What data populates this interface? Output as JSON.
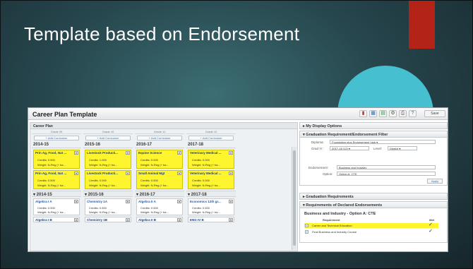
{
  "slide": {
    "title": "Template based on Endorsement",
    "colors": {
      "background": "#27474e",
      "accent_red": "#b32317",
      "accent_teal": "#46bfd0",
      "highlight": "#fff52e"
    }
  },
  "app": {
    "title": "Career Plan Template",
    "toolbar": {
      "icons": [
        "chart-icon",
        "grid-icon",
        "report-icon",
        "settings-icon",
        "print-icon",
        "help-icon"
      ],
      "save_label": "Save"
    }
  },
  "career_plan": {
    "header": "Career Plan",
    "columns": [
      {
        "grade": "Grade 09",
        "add": "+ Add Curriculum",
        "year": "2014-15",
        "courses": [
          {
            "name": "Prin Ag, Food, Nat ...",
            "credits": "Credits: 0.500",
            "weight": "Weight: N-Reg (+ ba..."
          },
          {
            "name": "Prin Ag, Food, Nat ...",
            "credits": "Credits: 0.500",
            "weight": "Weight: N-Reg (+ ba..."
          }
        ]
      },
      {
        "grade": "Grade 10",
        "add": "+ Add Curriculum",
        "year": "2015-16",
        "courses": [
          {
            "name": "Livestock Producti...",
            "credits": "Credits: 1.000",
            "weight": "Weight: N-Reg (+ ba..."
          },
          {
            "name": "Livestock Producti...",
            "credits": "Credits: 0.000",
            "weight": "Weight: N-Reg (+ ba..."
          }
        ]
      },
      {
        "grade": "Grade 11",
        "add": "+ Add Curriculum",
        "year": "2016-17",
        "courses": [
          {
            "name": "Equine Science",
            "credits": "Credits: 0.500",
            "weight": "Weight: N-Reg (+ ba..."
          },
          {
            "name": "Small Animal Mgt",
            "credits": "Credits: 0.500",
            "weight": "Weight: N-Reg (+ ba..."
          }
        ]
      },
      {
        "grade": "Grade 12",
        "add": "+ Add Curriculum",
        "year": "2017-18",
        "courses": [
          {
            "name": "Veterinary Medical ...",
            "credits": "Credits: 0.000",
            "weight": "Weight: N-Reg (+ ba..."
          },
          {
            "name": "Veterinary Medical ...",
            "credits": "Credits: 0.000",
            "weight": "Weight: N-Reg (+ ba..."
          }
        ]
      }
    ],
    "academic": [
      {
        "year": "▾ 2014-15",
        "course": "Algebra I A",
        "credits": "Credits: 0.500",
        "weight": "Weight: N-Reg (+ ba...",
        "next": "Algebra I B"
      },
      {
        "year": "▾ 2015-16",
        "course": "Chemistry 1A",
        "credits": "Credits: 0.500",
        "weight": "Weight: N-Reg (+ ba...",
        "next": "Chemistry 1B"
      },
      {
        "year": "▾ 2016-17",
        "course": "Algebra II A",
        "credits": "Credits: 0.500",
        "weight": "Weight: N-Reg (+ ba...",
        "next": "Algebra II B"
      },
      {
        "year": "▾ 2017-18",
        "course": "Economics 12th gr...",
        "credits": "Credits: 0.500",
        "weight": "Weight: N-Reg (+ ba...",
        "next": "ENG IV B"
      }
    ]
  },
  "right_panel": {
    "display_options": "▸ My Display Options",
    "filter": {
      "header": "▾ Graduation Requirement/Endorsement Filter",
      "diploma_label": "Diploma:",
      "diploma_value": "Foundation plus Endorsement high ▾",
      "grad_yr_label": "Grad Yr:",
      "grad_yr_value": "2017-18 (12) ▾",
      "level_label": "Level:",
      "level_value": "District ▾",
      "endorsement_label": "Endorsement:",
      "endorsement_value": "Business and Industry",
      "option_label": "Option:",
      "option_value": "Option A: CTE",
      "apply_label": "Apply"
    },
    "grad_requirements": "▸ Graduation Requirements",
    "declared": {
      "header": "▾ Requirements of Declared Endorsements",
      "title": "Business and Industry - Option A: CTE",
      "col_requirement": "Requirement",
      "col_met": "Met",
      "rows": [
        {
          "text": "Career and Technical Education",
          "met": "✓"
        },
        {
          "text": "Final Business and Industry Course",
          "met": "✓"
        }
      ]
    }
  }
}
